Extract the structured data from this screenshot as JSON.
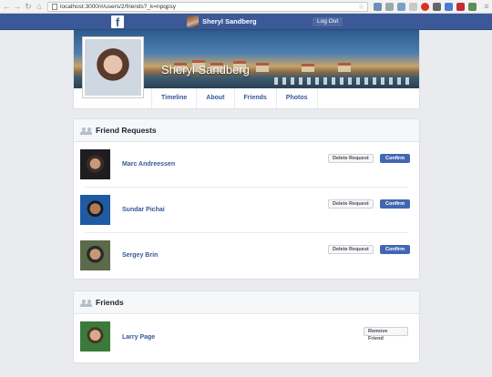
{
  "browser": {
    "url": "localhost:3000/#/users/2/friends?_k=npqpsy"
  },
  "header": {
    "logo": "f",
    "user_name": "Sheryl Sandberg",
    "logout_label": "Log Out"
  },
  "profile": {
    "name": "Sheryl Sandberg",
    "tabs": [
      "Timeline",
      "About",
      "Friends",
      "Photos"
    ]
  },
  "friend_requests": {
    "title": "Friend Requests",
    "delete_label": "Delete Request",
    "confirm_label": "Confirm",
    "items": [
      {
        "name": "Marc Andreessen"
      },
      {
        "name": "Sundar Pichai"
      },
      {
        "name": "Sergey Brin"
      }
    ]
  },
  "friends": {
    "title": "Friends",
    "remove_label": "Remove Friend",
    "items": [
      {
        "name": "Larry Page"
      }
    ]
  },
  "colors": {
    "brand": "#3b5998",
    "link": "#365899",
    "confirm": "#4267b2"
  }
}
